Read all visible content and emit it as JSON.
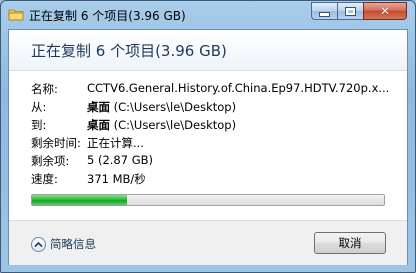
{
  "window": {
    "title": "正在复制 6 个项目(3.96 GB)"
  },
  "dialog": {
    "heading": "正在复制 6 个项目(3.96 GB)",
    "rows": [
      {
        "label": "名称:",
        "value": "CCTV6.General.History.of.China.Ep97.HDTV.720p.x..."
      },
      {
        "label": "从:",
        "value_bold": "桌面",
        "value": " (C:\\Users\\le\\Desktop)"
      },
      {
        "label": "到:",
        "value_bold": "桌面",
        "value": " (C:\\Users\\le\\Desktop)"
      },
      {
        "label": "剩余时间:",
        "value": "正在计算..."
      },
      {
        "label": "剩余项:",
        "value": "5 (2.87 GB)"
      },
      {
        "label": "速度:",
        "value": "371 MB/秒"
      }
    ],
    "progress": {
      "fraction": 0.27,
      "color": "#22b434"
    }
  },
  "footer": {
    "details_label": "简略信息",
    "cancel_label": "取消"
  },
  "icons": {
    "app": "copy-folder-icon",
    "minimize": "minimize-icon",
    "maximize": "maximize-icon",
    "close": "close-icon",
    "details": "chevron-up-icon"
  }
}
